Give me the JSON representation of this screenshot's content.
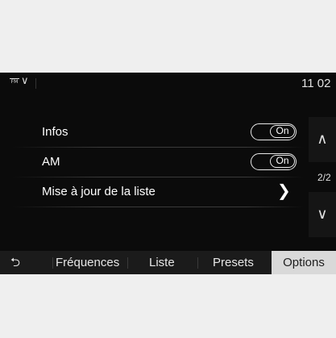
{
  "status_bar": {
    "source_icon": "fm-radio-icon",
    "source_icon_text": "FM",
    "dropdown_icon": "chevron-down-icon",
    "clock": "11 02"
  },
  "options": [
    {
      "label": "Infos",
      "control": "toggle",
      "value": "On"
    },
    {
      "label": "AM",
      "control": "toggle",
      "value": "On"
    },
    {
      "label": "Mise à jour de la liste",
      "control": "chevron-right-icon"
    }
  ],
  "scroll": {
    "up_icon": "chevron-up-icon",
    "down_icon": "chevron-down-icon",
    "page": "2/2"
  },
  "tabs": {
    "back_icon": "back-arrow-icon",
    "items": [
      {
        "label": "Fréquences",
        "active": false
      },
      {
        "label": "Liste",
        "active": false
      },
      {
        "label": "Presets",
        "active": false
      },
      {
        "label": "Options",
        "active": true
      }
    ]
  },
  "colors": {
    "screen_bg": "#0b0b0b",
    "frame_bg": "#efefef",
    "active_tab_bg": "#d9d9d9",
    "text": "#ffffff"
  }
}
